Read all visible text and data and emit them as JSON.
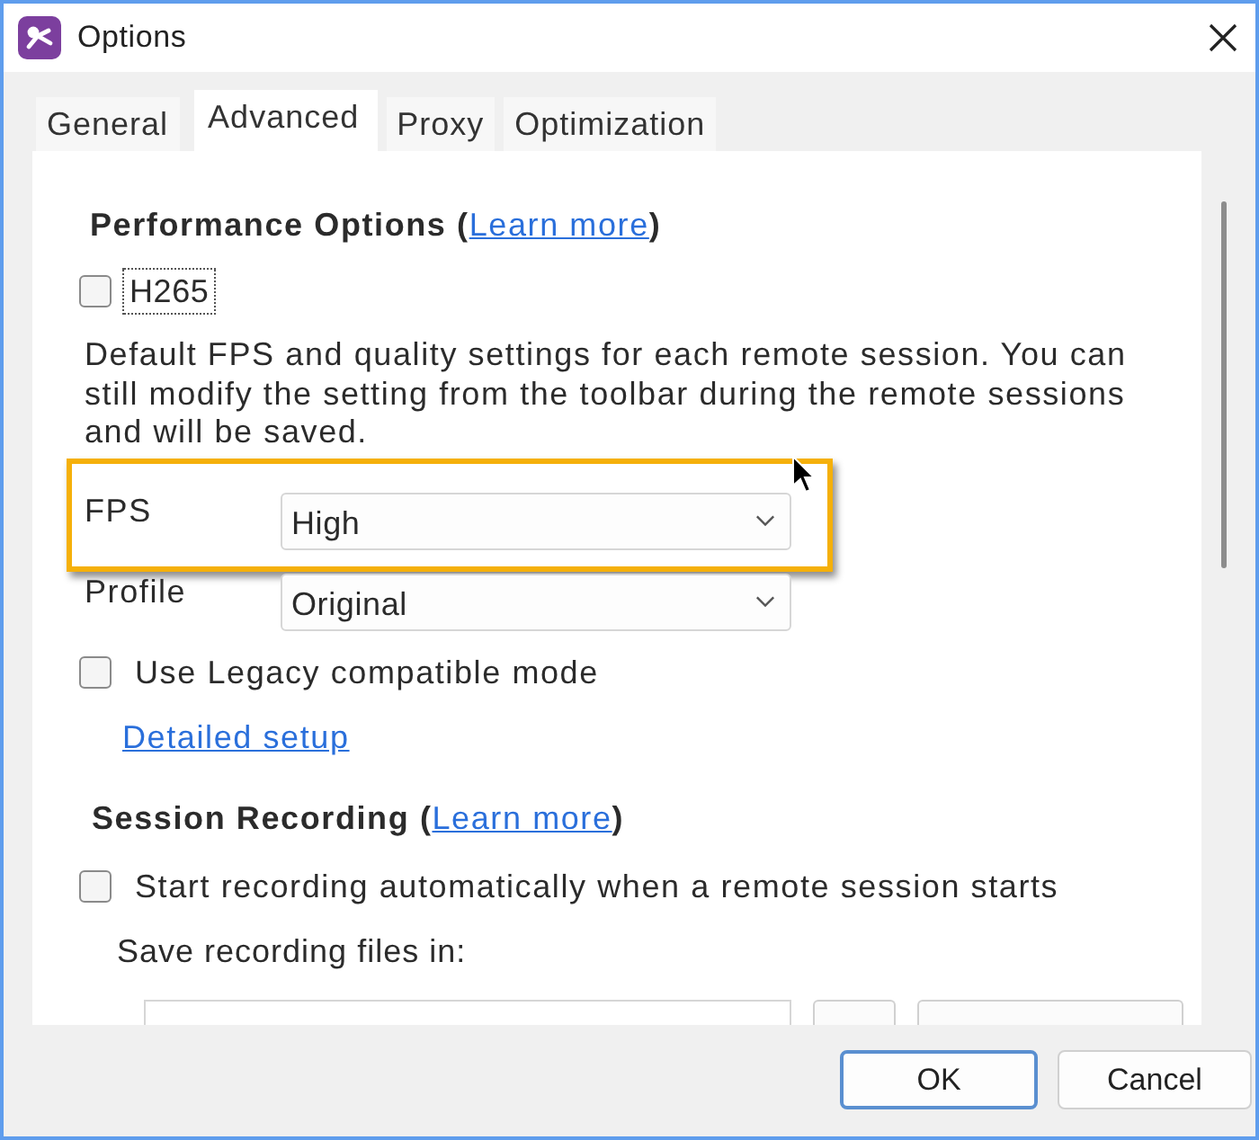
{
  "window": {
    "title": "Options"
  },
  "tabs": [
    {
      "label": "General",
      "selected": false
    },
    {
      "label": "Advanced",
      "selected": true
    },
    {
      "label": "Proxy",
      "selected": false
    },
    {
      "label": "Optimization",
      "selected": false
    }
  ],
  "performance_options": {
    "title": "Performance Options (",
    "link": "Learn more",
    "title_end": ")",
    "h265": {
      "label": "H265",
      "checked": false,
      "focused": true
    },
    "description": "Default FPS and quality settings for each remote session. You can still modify the setting from the toolbar during the remote sessions and will be saved.",
    "settings": [
      {
        "label": "FPS",
        "value": "High",
        "highlighted": true
      },
      {
        "label": "Profile",
        "value": "Original",
        "highlighted": false
      }
    ],
    "legacy_mode": {
      "label": "Use Legacy compatible mode",
      "checked": false
    },
    "detailed_setup_link": "Detailed setup"
  },
  "session_recording": {
    "title": "Session Recording (",
    "link": "Learn more",
    "title_end": ")",
    "auto_start": {
      "label": "Start recording automatically when a remote session starts",
      "checked": false
    },
    "save_location_label": "Save recording files in:"
  },
  "buttons": [
    {
      "label": "OK",
      "default": true
    },
    {
      "label": "Cancel",
      "default": false
    }
  ]
}
